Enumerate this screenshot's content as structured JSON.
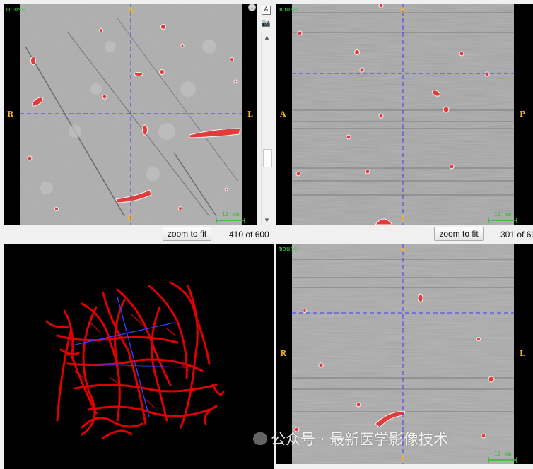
{
  "views": {
    "axial": {
      "mouse_label": "mouse",
      "orientation": {
        "top": "A",
        "bottom": "P",
        "left": "R",
        "right": "L"
      },
      "scale_label": "10 mm",
      "zoom_button": "zoom to fit",
      "slice_counter": "410 of 600"
    },
    "sagittal": {
      "mouse_label": "mouse",
      "orientation": {
        "top": "S",
        "bottom": "I",
        "left": "A",
        "right": "P"
      },
      "scale_label": "10 mm",
      "zoom_button": "zoom to fit",
      "slice_counter": "301 of 60"
    },
    "coronal": {
      "mouse_label": "mouse",
      "orientation": {
        "top": "S",
        "bottom": "I",
        "left": "R",
        "right": "L"
      },
      "scale_label": "10 mm"
    },
    "render3d": {}
  },
  "toolbar": {
    "text_tool": "A",
    "camera_tool": "📷",
    "menu_arrow": "⌄",
    "scroll_up": "▲",
    "scroll_down": "▼"
  },
  "watermark": "公众号 · 最新医学影像技术",
  "colors": {
    "vessel_red": "#e53a3a",
    "crosshair": "#3c3cff",
    "orientation_label": "#f1b426",
    "render_vessel": "#e10000",
    "render_axis": "#3a3aff"
  },
  "icons": {
    "camera": "camera-icon",
    "text": "text-tool-icon",
    "menu": "chevron-down-icon"
  }
}
